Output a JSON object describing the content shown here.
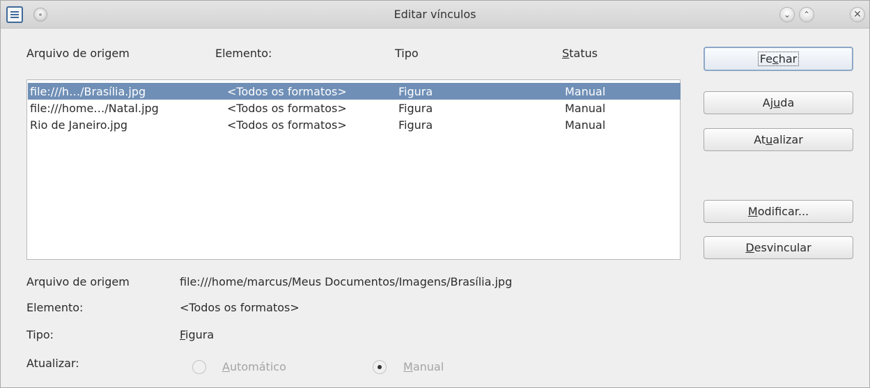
{
  "window": {
    "title": "Editar vínculos",
    "controls": {
      "minimize": "⌄",
      "maximize": "⌃",
      "close": "✕"
    }
  },
  "columns": {
    "source_pre": "Arquivo de origem",
    "element": "Elemento:",
    "type": "Tipo",
    "status_first": "S",
    "status_rest": "tatus"
  },
  "rows": [
    {
      "source": "file:///h…/Brasília.jpg",
      "element": "<Todos os formatos>",
      "type": "Figura",
      "status": "Manual",
      "selected": true
    },
    {
      "source": "file:///home…/Natal.jpg",
      "element": "<Todos os formatos>",
      "type": "Figura",
      "status": "Manual",
      "selected": false
    },
    {
      "source": "Rio de Janeiro.jpg",
      "element": "<Todos os formatos>",
      "type": "Figura",
      "status": "Manual",
      "selected": false
    }
  ],
  "buttons": {
    "close": {
      "pre": "Fe",
      "key": "c",
      "post": "har"
    },
    "help": {
      "pre": "Aj",
      "key": "u",
      "post": "da"
    },
    "update": {
      "pre": "At",
      "key": "u",
      "post": "alizar"
    },
    "modify": {
      "pre": "",
      "key": "M",
      "post": "odificar..."
    },
    "unlink": {
      "pre": "",
      "key": "D",
      "post": "esvincular"
    }
  },
  "details": {
    "source_label": "Arquivo de origem",
    "source_value": "file:///home/marcus/Meus Documentos/Imagens/Brasília.jpg",
    "element_label": "Elemento:",
    "element_value": "<Todos os formatos>",
    "type_label": "Tipo:",
    "type_value_key": "F",
    "type_value_rest": "igura",
    "update_label": "Atualizar:",
    "auto_key": "A",
    "auto_rest": "utomático",
    "manual_key": "M",
    "manual_rest": "anual"
  }
}
